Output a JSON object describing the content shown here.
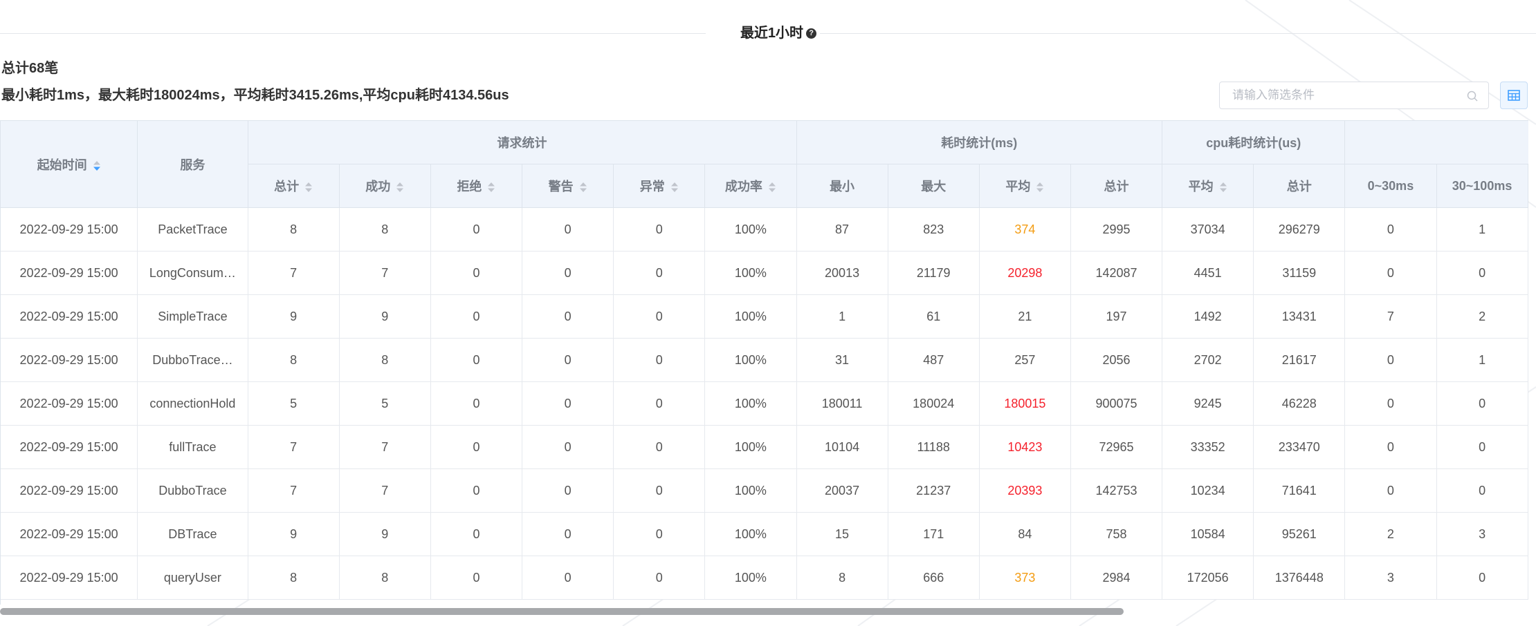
{
  "header": {
    "title": "最近1小时"
  },
  "summary": {
    "total": "总计68笔",
    "stats": "最小耗时1ms，最大耗时180024ms，平均耗时3415.26ms,平均cpu耗时4134.56us"
  },
  "search": {
    "placeholder": "请输入筛选条件"
  },
  "colors": {
    "warn": "#f39c12",
    "danger": "#f5222d",
    "accent": "#409eff"
  },
  "table": {
    "col_start_time": "起始时间",
    "col_service": "服务",
    "groups": {
      "request": "请求统计",
      "duration": "耗时统计(ms)",
      "cpu": "cpu耗时统计(us)"
    },
    "request_cols": [
      "总计",
      "成功",
      "拒绝",
      "警告",
      "异常",
      "成功率"
    ],
    "duration_cols": [
      "最小",
      "最大",
      "平均",
      "总计"
    ],
    "cpu_cols": [
      "平均",
      "总计"
    ],
    "bucket_cols": [
      "0~30ms",
      "30~100ms"
    ],
    "rows": [
      {
        "time": "2022-09-29 15:00",
        "service": "PacketTrace",
        "total": "8",
        "success": "8",
        "reject": "0",
        "warning": "0",
        "error": "0",
        "rate": "100%",
        "min": "87",
        "max": "823",
        "avg": "374",
        "avg_level": "warn",
        "sum": "2995",
        "cpu_avg": "37034",
        "cpu_sum": "296279",
        "b0": "0",
        "b1": "1"
      },
      {
        "time": "2022-09-29 15:00",
        "service": "LongConsum…",
        "total": "7",
        "success": "7",
        "reject": "0",
        "warning": "0",
        "error": "0",
        "rate": "100%",
        "min": "20013",
        "max": "21179",
        "avg": "20298",
        "avg_level": "danger",
        "sum": "142087",
        "cpu_avg": "4451",
        "cpu_sum": "31159",
        "b0": "0",
        "b1": "0"
      },
      {
        "time": "2022-09-29 15:00",
        "service": "SimpleTrace",
        "total": "9",
        "success": "9",
        "reject": "0",
        "warning": "0",
        "error": "0",
        "rate": "100%",
        "min": "1",
        "max": "61",
        "avg": "21",
        "avg_level": "normal",
        "sum": "197",
        "cpu_avg": "1492",
        "cpu_sum": "13431",
        "b0": "7",
        "b1": "2"
      },
      {
        "time": "2022-09-29 15:00",
        "service": "DubboTrace…",
        "total": "8",
        "success": "8",
        "reject": "0",
        "warning": "0",
        "error": "0",
        "rate": "100%",
        "min": "31",
        "max": "487",
        "avg": "257",
        "avg_level": "normal",
        "sum": "2056",
        "cpu_avg": "2702",
        "cpu_sum": "21617",
        "b0": "0",
        "b1": "1"
      },
      {
        "time": "2022-09-29 15:00",
        "service": "connectionHold",
        "total": "5",
        "success": "5",
        "reject": "0",
        "warning": "0",
        "error": "0",
        "rate": "100%",
        "min": "180011",
        "max": "180024",
        "avg": "180015",
        "avg_level": "danger",
        "sum": "900075",
        "cpu_avg": "9245",
        "cpu_sum": "46228",
        "b0": "0",
        "b1": "0"
      },
      {
        "time": "2022-09-29 15:00",
        "service": "fullTrace",
        "total": "7",
        "success": "7",
        "reject": "0",
        "warning": "0",
        "error": "0",
        "rate": "100%",
        "min": "10104",
        "max": "11188",
        "avg": "10423",
        "avg_level": "danger",
        "sum": "72965",
        "cpu_avg": "33352",
        "cpu_sum": "233470",
        "b0": "0",
        "b1": "0"
      },
      {
        "time": "2022-09-29 15:00",
        "service": "DubboTrace",
        "total": "7",
        "success": "7",
        "reject": "0",
        "warning": "0",
        "error": "0",
        "rate": "100%",
        "min": "20037",
        "max": "21237",
        "avg": "20393",
        "avg_level": "danger",
        "sum": "142753",
        "cpu_avg": "10234",
        "cpu_sum": "71641",
        "b0": "0",
        "b1": "0"
      },
      {
        "time": "2022-09-29 15:00",
        "service": "DBTrace",
        "total": "9",
        "success": "9",
        "reject": "0",
        "warning": "0",
        "error": "0",
        "rate": "100%",
        "min": "15",
        "max": "171",
        "avg": "84",
        "avg_level": "normal",
        "sum": "758",
        "cpu_avg": "10584",
        "cpu_sum": "95261",
        "b0": "2",
        "b1": "3"
      },
      {
        "time": "2022-09-29 15:00",
        "service": "queryUser",
        "total": "8",
        "success": "8",
        "reject": "0",
        "warning": "0",
        "error": "0",
        "rate": "100%",
        "min": "8",
        "max": "666",
        "avg": "373",
        "avg_level": "warn",
        "sum": "2984",
        "cpu_avg": "172056",
        "cpu_sum": "1376448",
        "b0": "3",
        "b1": "0"
      }
    ]
  }
}
